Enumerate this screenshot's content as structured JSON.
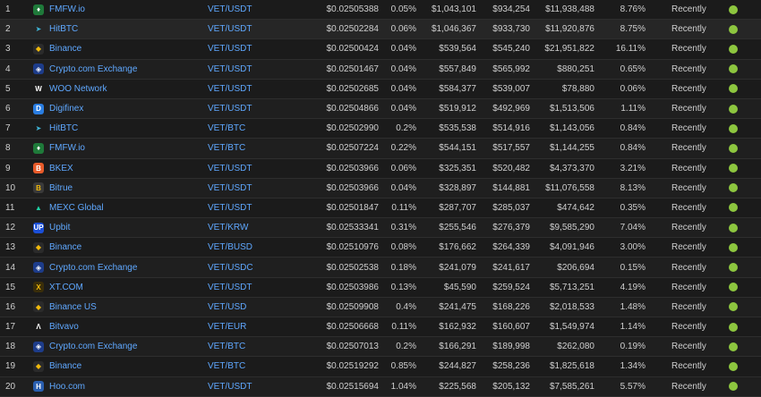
{
  "colors": {
    "link": "#5fa8ff",
    "trust_green": "#8dc63f",
    "background": "#1b1b1b"
  },
  "rows": [
    {
      "rank": "1",
      "exchange": "FMFW.io",
      "icon": "fmfw-icon",
      "pair": "VET/USDT",
      "price": "$0.02505388",
      "spread": "0.05%",
      "depth_plus": "$1,043,101",
      "depth_minus": "$934,254",
      "volume": "$11,938,488",
      "share": "8.76%",
      "updated": "Recently",
      "trust": "green"
    },
    {
      "rank": "2",
      "exchange": "HitBTC",
      "icon": "hitbtc-icon",
      "pair": "VET/USDT",
      "price": "$0.02502284",
      "spread": "0.06%",
      "depth_plus": "$1,046,367",
      "depth_minus": "$933,730",
      "volume": "$11,920,876",
      "share": "8.75%",
      "updated": "Recently",
      "trust": "green"
    },
    {
      "rank": "3",
      "exchange": "Binance",
      "icon": "binance-icon",
      "pair": "VET/USDT",
      "price": "$0.02500424",
      "spread": "0.04%",
      "depth_plus": "$539,564",
      "depth_minus": "$545,240",
      "volume": "$21,951,822",
      "share": "16.11%",
      "updated": "Recently",
      "trust": "green"
    },
    {
      "rank": "4",
      "exchange": "Crypto.com Exchange",
      "icon": "crypto-com-icon",
      "pair": "VET/USDT",
      "price": "$0.02501467",
      "spread": "0.04%",
      "depth_plus": "$557,849",
      "depth_minus": "$565,992",
      "volume": "$880,251",
      "share": "0.65%",
      "updated": "Recently",
      "trust": "green"
    },
    {
      "rank": "5",
      "exchange": "WOO Network",
      "icon": "woo-icon",
      "pair": "VET/USDT",
      "price": "$0.02502685",
      "spread": "0.04%",
      "depth_plus": "$584,377",
      "depth_minus": "$539,007",
      "volume": "$78,880",
      "share": "0.06%",
      "updated": "Recently",
      "trust": "green"
    },
    {
      "rank": "6",
      "exchange": "Digifinex",
      "icon": "digifinex-icon",
      "pair": "VET/USDT",
      "price": "$0.02504866",
      "spread": "0.04%",
      "depth_plus": "$519,912",
      "depth_minus": "$492,969",
      "volume": "$1,513,506",
      "share": "1.11%",
      "updated": "Recently",
      "trust": "green"
    },
    {
      "rank": "7",
      "exchange": "HitBTC",
      "icon": "hitbtc-icon",
      "pair": "VET/BTC",
      "price": "$0.02502990",
      "spread": "0.2%",
      "depth_plus": "$535,538",
      "depth_minus": "$514,916",
      "volume": "$1,143,056",
      "share": "0.84%",
      "updated": "Recently",
      "trust": "green"
    },
    {
      "rank": "8",
      "exchange": "FMFW.io",
      "icon": "fmfw-icon",
      "pair": "VET/BTC",
      "price": "$0.02507224",
      "spread": "0.22%",
      "depth_plus": "$544,151",
      "depth_minus": "$517,557",
      "volume": "$1,144,255",
      "share": "0.84%",
      "updated": "Recently",
      "trust": "green"
    },
    {
      "rank": "9",
      "exchange": "BKEX",
      "icon": "bkex-icon",
      "pair": "VET/USDT",
      "price": "$0.02503966",
      "spread": "0.06%",
      "depth_plus": "$325,351",
      "depth_minus": "$520,482",
      "volume": "$4,373,370",
      "share": "3.21%",
      "updated": "Recently",
      "trust": "green"
    },
    {
      "rank": "10",
      "exchange": "Bitrue",
      "icon": "bitrue-icon",
      "pair": "VET/USDT",
      "price": "$0.02503966",
      "spread": "0.04%",
      "depth_plus": "$328,897",
      "depth_minus": "$144,881",
      "volume": "$11,076,558",
      "share": "8.13%",
      "updated": "Recently",
      "trust": "green"
    },
    {
      "rank": "11",
      "exchange": "MEXC Global",
      "icon": "mexc-icon",
      "pair": "VET/USDT",
      "price": "$0.02501847",
      "spread": "0.11%",
      "depth_plus": "$287,707",
      "depth_minus": "$285,037",
      "volume": "$474,642",
      "share": "0.35%",
      "updated": "Recently",
      "trust": "green"
    },
    {
      "rank": "12",
      "exchange": "Upbit",
      "icon": "upbit-icon",
      "pair": "VET/KRW",
      "price": "$0.02533341",
      "spread": "0.31%",
      "depth_plus": "$255,546",
      "depth_minus": "$276,379",
      "volume": "$9,585,290",
      "share": "7.04%",
      "updated": "Recently",
      "trust": "green"
    },
    {
      "rank": "13",
      "exchange": "Binance",
      "icon": "binance-icon",
      "pair": "VET/BUSD",
      "price": "$0.02510976",
      "spread": "0.08%",
      "depth_plus": "$176,662",
      "depth_minus": "$264,339",
      "volume": "$4,091,946",
      "share": "3.00%",
      "updated": "Recently",
      "trust": "green"
    },
    {
      "rank": "14",
      "exchange": "Crypto.com Exchange",
      "icon": "crypto-com-icon",
      "pair": "VET/USDC",
      "price": "$0.02502538",
      "spread": "0.18%",
      "depth_plus": "$241,079",
      "depth_minus": "$241,617",
      "volume": "$206,694",
      "share": "0.15%",
      "updated": "Recently",
      "trust": "green"
    },
    {
      "rank": "15",
      "exchange": "XT.COM",
      "icon": "xt-icon",
      "pair": "VET/USDT",
      "price": "$0.02503986",
      "spread": "0.13%",
      "depth_plus": "$45,590",
      "depth_minus": "$259,524",
      "volume": "$5,713,251",
      "share": "4.19%",
      "updated": "Recently",
      "trust": "green"
    },
    {
      "rank": "16",
      "exchange": "Binance US",
      "icon": "binance-icon",
      "pair": "VET/USD",
      "price": "$0.02509908",
      "spread": "0.4%",
      "depth_plus": "$241,475",
      "depth_minus": "$168,226",
      "volume": "$2,018,533",
      "share": "1.48%",
      "updated": "Recently",
      "trust": "green"
    },
    {
      "rank": "17",
      "exchange": "Bitvavo",
      "icon": "bitvavo-icon",
      "pair": "VET/EUR",
      "price": "$0.02506668",
      "spread": "0.11%",
      "depth_plus": "$162,932",
      "depth_minus": "$160,607",
      "volume": "$1,549,974",
      "share": "1.14%",
      "updated": "Recently",
      "trust": "green"
    },
    {
      "rank": "18",
      "exchange": "Crypto.com Exchange",
      "icon": "crypto-com-icon",
      "pair": "VET/BTC",
      "price": "$0.02507013",
      "spread": "0.2%",
      "depth_plus": "$166,291",
      "depth_minus": "$189,998",
      "volume": "$262,080",
      "share": "0.19%",
      "updated": "Recently",
      "trust": "green"
    },
    {
      "rank": "19",
      "exchange": "Binance",
      "icon": "binance-icon",
      "pair": "VET/BTC",
      "price": "$0.02519292",
      "spread": "0.85%",
      "depth_plus": "$244,827",
      "depth_minus": "$258,236",
      "volume": "$1,825,618",
      "share": "1.34%",
      "updated": "Recently",
      "trust": "green"
    },
    {
      "rank": "20",
      "exchange": "Hoo.com",
      "icon": "hoo-icon",
      "pair": "VET/USDT",
      "price": "$0.02515694",
      "spread": "1.04%",
      "depth_plus": "$225,568",
      "depth_minus": "$205,132",
      "volume": "$7,585,261",
      "share": "5.57%",
      "updated": "Recently",
      "trust": "green"
    }
  ]
}
